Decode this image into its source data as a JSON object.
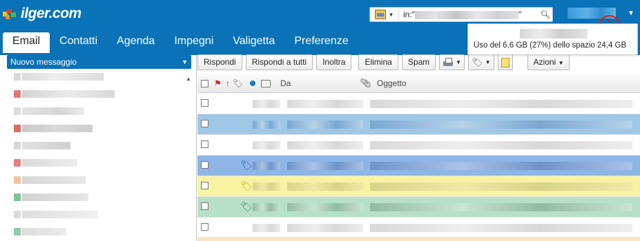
{
  "brand": {
    "logo_text": "ilger.com"
  },
  "search": {
    "query_prefix": "in:\"",
    "query_suffix": "\""
  },
  "account": {
    "name_hidden": true
  },
  "badge": {
    "number": "1",
    "color": "#d52020"
  },
  "quota": {
    "text": "Uso del 6,6 GB (27%) dello spazio 24,4 GB",
    "used_gb": 6.6,
    "total_gb": 24.4,
    "percent": 27
  },
  "tabs": [
    "Email",
    "Contatti",
    "Agenda",
    "Impegni",
    "Valigetta",
    "Preferenze"
  ],
  "sidebar": {
    "new_message": "Nuovo messaggio"
  },
  "toolbar": {
    "reply": "Rispondi",
    "reply_all": "Rispondi a tutti",
    "forward": "Inoltra",
    "delete": "Elimina",
    "spam": "Spam",
    "actions": "Azioni"
  },
  "list_header": {
    "from": "Da",
    "subject": "Oggetto"
  },
  "colors": {
    "header_blue": "#0a72b6",
    "row_selected": "#9fc7e6",
    "row_tag_blue": "#8fb4e6",
    "row_tag_yellow": "#f7f3a3",
    "row_tag_green": "#b8dfc8",
    "accent_red": "#d52020"
  },
  "rows": [
    {
      "style": "plain",
      "tag": ""
    },
    {
      "style": "selected",
      "tag": ""
    },
    {
      "style": "plain",
      "tag": ""
    },
    {
      "style": "blue",
      "tag": "tag-blue-icon"
    },
    {
      "style": "yellow",
      "tag": "tag-yellow-icon"
    },
    {
      "style": "green",
      "tag": "tag-green-icon"
    },
    {
      "style": "plain",
      "tag": ""
    }
  ]
}
